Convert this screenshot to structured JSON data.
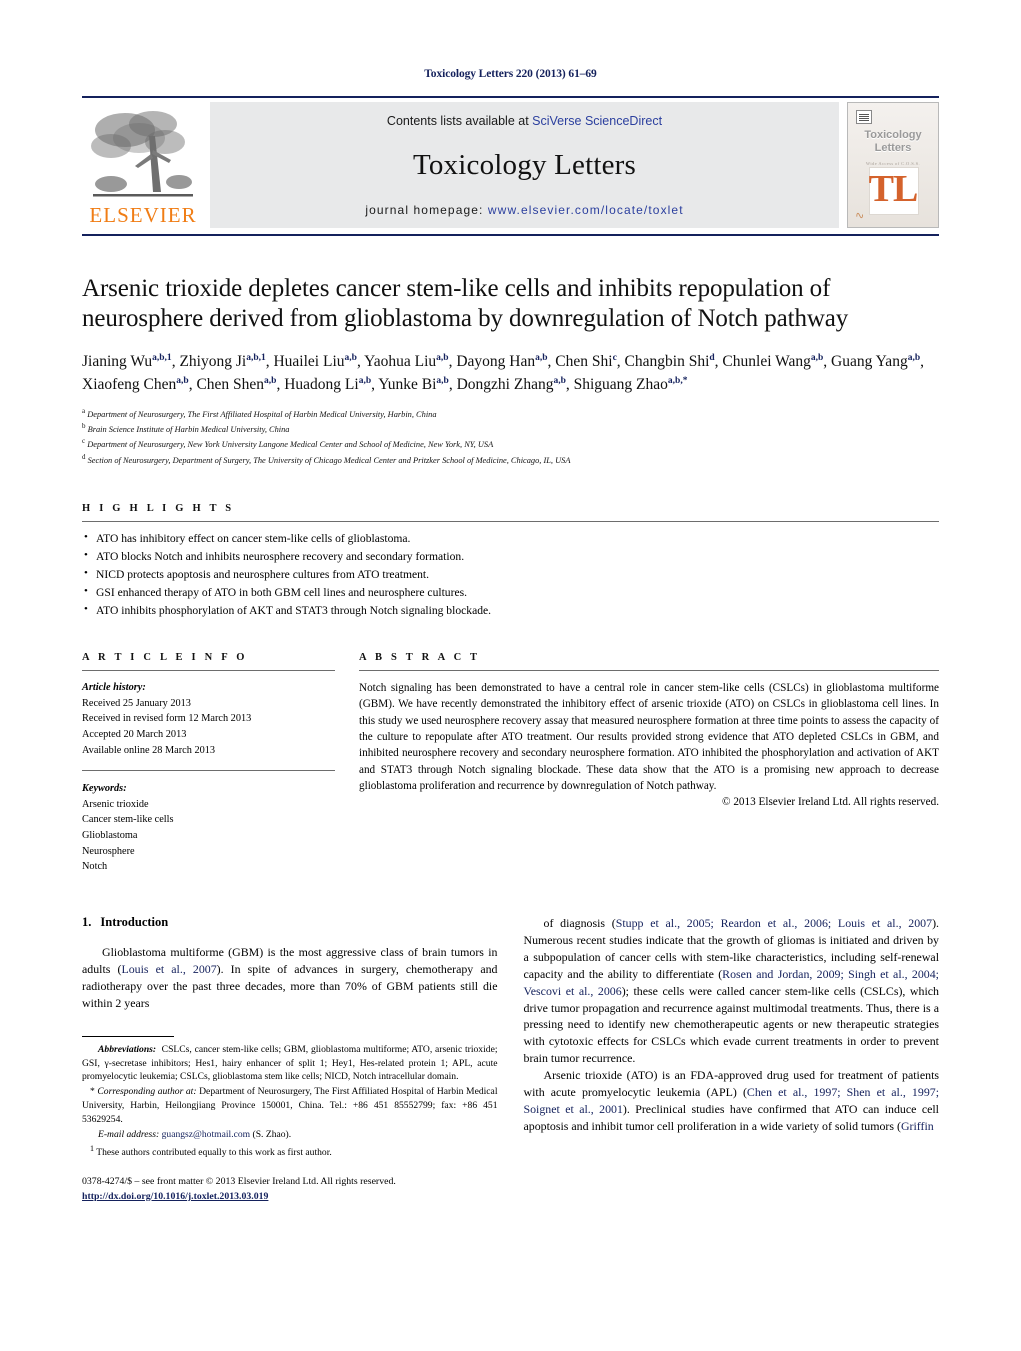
{
  "running_head": "Toxicology Letters 220 (2013) 61–69",
  "masthead": {
    "contents_prefix": "Contents lists available at ",
    "contents_link": "SciVerse ScienceDirect",
    "journal_title": "Toxicology Letters",
    "homepage_prefix": "journal homepage: ",
    "homepage_link": "www.elsevier.com/locate/toxlet",
    "publisher": "ELSEVIER",
    "cover": {
      "title_line1": "Toxicology",
      "title_line2": "Letters",
      "subtitle": "Wide Access of C.O.S.S.",
      "monogram": "TL"
    },
    "accent_orange": "#f07d15",
    "accent_blue": "#14215c",
    "band_gray": "#e8e9ea"
  },
  "article": {
    "title": "Arsenic trioxide depletes cancer stem-like cells and inhibits repopulation of neurosphere derived from glioblastoma by downregulation of Notch pathway",
    "authors_html": "Jianing Wu<sup>a,b,1</sup>, Zhiyong Ji<sup>a,b,1</sup>, Huailei Liu<sup>a,b</sup>, Yaohua Liu<sup>a,b</sup>, Dayong Han<sup>a,b</sup>, Chen Shi<sup>c</sup>, Changbin Shi<sup>d</sup>, Chunlei Wang<sup>a,b</sup>, Guang Yang<sup>a,b</sup>, Xiaofeng Chen<sup>a,b</sup>, Chen Shen<sup>a,b</sup>, Huadong Li<sup>a,b</sup>, Yunke Bi<sup>a,b</sup>, Dongzhi Zhang<sup>a,b</sup>, Shiguang Zhao<sup>a,b,*</sup>",
    "affiliations": [
      {
        "marker": "a",
        "text": "Department of Neurosurgery, The First Affiliated Hospital of Harbin Medical University, Harbin, China"
      },
      {
        "marker": "b",
        "text": "Brain Science Institute of Harbin Medical University, China"
      },
      {
        "marker": "c",
        "text": "Department of Neurosurgery, New York University Langone Medical Center and School of Medicine, New York, NY, USA"
      },
      {
        "marker": "d",
        "text": "Section of Neurosurgery, Department of Surgery, The University of Chicago Medical Center and Pritzker School of Medicine, Chicago, IL, USA"
      }
    ]
  },
  "highlights": {
    "label": "H I G H L I G H T S",
    "items": [
      "ATO has inhibitory effect on cancer stem-like cells of glioblastoma.",
      "ATO blocks Notch and inhibits neurosphere recovery and secondary formation.",
      "NICD protects apoptosis and neurosphere cultures from ATO treatment.",
      "GSI enhanced therapy of ATO in both GBM cell lines and neurosphere cultures.",
      "ATO inhibits phosphorylation of AKT and STAT3 through Notch signaling blockade."
    ]
  },
  "article_info": {
    "label": "A R T I C L E    I N F O",
    "history_head": "Article history:",
    "history": [
      "Received 25 January 2013",
      "Received in revised form 12 March 2013",
      "Accepted 20 March 2013",
      "Available online 28 March 2013"
    ],
    "keywords_head": "Keywords:",
    "keywords": [
      "Arsenic trioxide",
      "Cancer stem-like cells",
      "Glioblastoma",
      "Neurosphere",
      "Notch"
    ]
  },
  "abstract": {
    "label": "A B S T R A C T",
    "text": "Notch signaling has been demonstrated to have a central role in cancer stem-like cells (CSLCs) in glioblastoma multiforme (GBM). We have recently demonstrated the inhibitory effect of arsenic trioxide (ATO) on CSLCs in glioblastoma cell lines. In this study we used neurosphere recovery assay that measured neurosphere formation at three time points to assess the capacity of the culture to repopulate after ATO treatment. Our results provided strong evidence that ATO depleted CSLCs in GBM, and inhibited neurosphere recovery and secondary neurosphere formation. ATO inhibited the phosphorylation and activation of AKT and STAT3 through Notch signaling blockade. These data show that the ATO is a promising new approach to decrease glioblastoma proliferation and recurrence by downregulation of Notch pathway.",
    "copyright": "© 2013 Elsevier Ireland Ltd. All rights reserved."
  },
  "introduction": {
    "number": "1.",
    "heading": "Introduction",
    "left_para_1_html": "Glioblastoma multiforme (GBM) is the most aggressive class of brain tumors in adults (<a class=\"ref\" href=\"#\">Louis et al., 2007</a>). In spite of advances in surgery, chemotherapy and radiotherapy over the past three decades, more than 70% of GBM patients still die within 2 years",
    "right_para_1_html": "of diagnosis (<a class=\"ref\" href=\"#\">Stupp et al., 2005; Reardon et al., 2006; Louis et al., 2007</a>). Numerous recent studies indicate that the growth of gliomas is initiated and driven by a subpopulation of cancer cells with stem-like characteristics, including self-renewal capacity and the ability to differentiate (<a class=\"ref\" href=\"#\">Rosen and Jordan, 2009; Singh et al., 2004; Vescovi et al., 2006</a>); these cells were called cancer stem-like cells (CSLCs), which drive tumor propagation and recurrence against multimodal treatments. Thus, there is a pressing need to identify new chemotherapeutic agents or new therapeutic strategies with cytotoxic effects for CSLCs which evade current treatments in order to prevent brain tumor recurrence.",
    "right_para_2_html": "Arsenic trioxide (ATO) is an FDA-approved drug used for treatment of patients with acute promyelocytic leukemia (APL) (<a class=\"ref\" href=\"#\">Chen et al., 1997; Shen et al., 1997; Soignet et al., 2001</a>). Preclinical studies have confirmed that ATO can induce cell apoptosis and inhibit tumor cell proliferation in a wide variety of solid tumors (<a class=\"ref\" href=\"#\">Griffin</a>"
  },
  "footnotes": {
    "abbreviations_html": "<i><b>Abbreviations:</b></i>&nbsp; CSLCs, cancer stem-like cells; GBM, glioblastoma multiforme; ATO, arsenic trioxide; GSI, γ-secretase inhibitors; Hes1, hairy enhancer of split 1; Hey1, Hes-related protein 1; APL, acute promyelocytic leukemia; CSLCs, glioblastoma stem like cells; NICD, Notch intracellular domain.",
    "corresponding_html": "* <i>Corresponding author at:</i> Department of Neurosurgery, The First Affiliated Hospital of Harbin Medical University, Harbin, Heilongjiang Province 150001, China. Tel.: +86 451 85552799; fax: +86 451 53629254.",
    "email_prefix": "E-mail address:",
    "email": "guangsz@hotmail.com",
    "email_suffix": "(S. Zhao).",
    "equal_contrib": "These authors contributed equally to this work as first author.",
    "equal_marker": "1"
  },
  "imprint": {
    "front_matter": "0378-4274/$ – see front matter © 2013 Elsevier Ireland Ltd. All rights reserved.",
    "doi": "http://dx.doi.org/10.1016/j.toxlet.2013.03.019"
  }
}
